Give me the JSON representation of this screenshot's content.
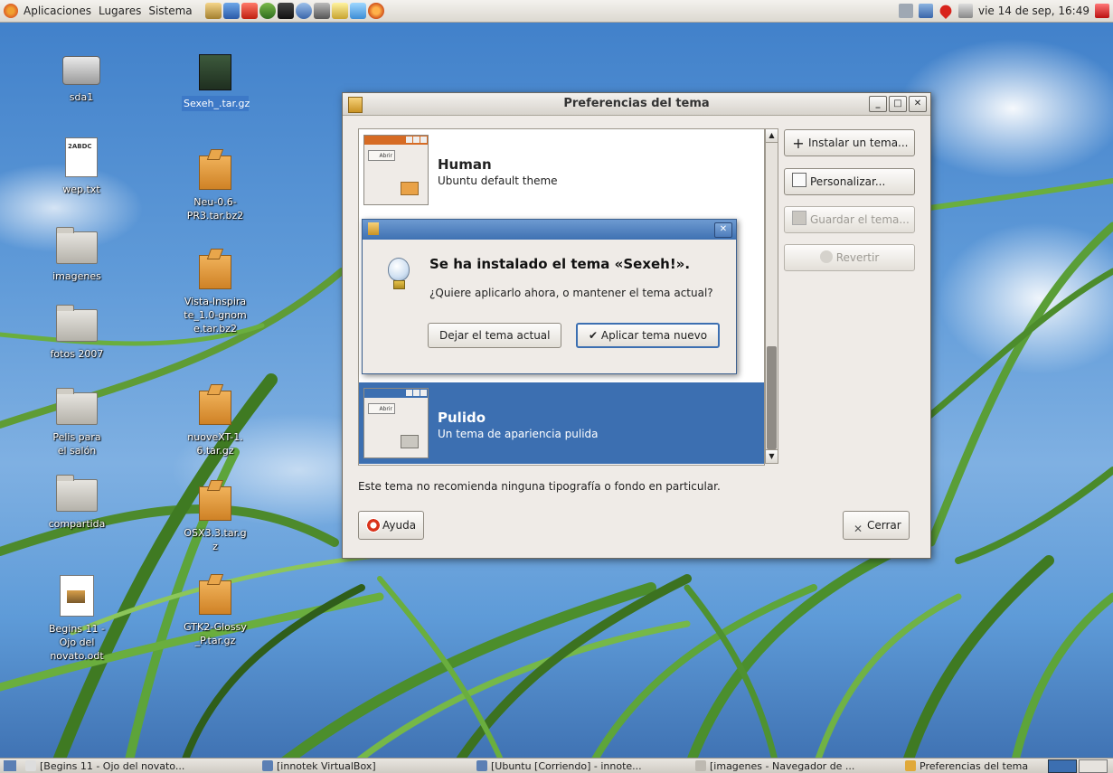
{
  "top_panel": {
    "menus": [
      "Aplicaciones",
      "Lugares",
      "Sistema"
    ],
    "clock": "vie 14 de sep, 16:49"
  },
  "desktop_icons": [
    {
      "label": "sda1"
    },
    {
      "label": "wep.txt"
    },
    {
      "label": "imagenes"
    },
    {
      "label": "fotos 2007"
    },
    {
      "label": "Pelis para el salón"
    },
    {
      "label": "compartida"
    },
    {
      "label": "Begins 11 - Ojo del novato.odt"
    },
    {
      "label": "Sexeh_.tar.gz"
    },
    {
      "label": "Neu-0.6-PR3.tar.bz2"
    },
    {
      "label": "Vista-Inspirate_1.0-gnome.tar.bz2"
    },
    {
      "label": "nuoveXT-1.6.tar.gz"
    },
    {
      "label": "OSX3.3.tar.gz"
    },
    {
      "label": "GTK2-Glossy_P.tar.gz"
    }
  ],
  "window": {
    "title": "Preferencias del tema",
    "themes": [
      {
        "name": "Human",
        "desc": "Ubuntu default theme",
        "abrir": "Abrir"
      },
      {
        "name": "Pulido",
        "desc": "Un tema de apariencia pulida",
        "abrir": "Abrir",
        "selected": true
      }
    ],
    "buttons": {
      "install": "Instalar un tema...",
      "customize": "Personalizar...",
      "save": "Guardar el tema...",
      "revert": "Revertir",
      "help": "Ayuda",
      "close": "Cerrar"
    },
    "note": "Este tema no recomienda ninguna tipografía o fondo en particular."
  },
  "dialog": {
    "heading": "Se ha instalado el tema «Sexeh!».",
    "message": "¿Quiere aplicarlo ahora, o mantener el tema actual?",
    "keep_button": "Dejar el tema actual",
    "apply_button": "Aplicar tema nuevo"
  },
  "taskbar": {
    "tasks": [
      "[Begins 11 - Ojo del novato...",
      "[innotek VirtualBox]",
      "[Ubuntu [Corriendo] - innote...",
      "[imagenes - Navegador de ...",
      "Preferencias del tema"
    ]
  },
  "colors": {
    "selection": "#3c6fb1",
    "title_active": "#3f71b2"
  }
}
